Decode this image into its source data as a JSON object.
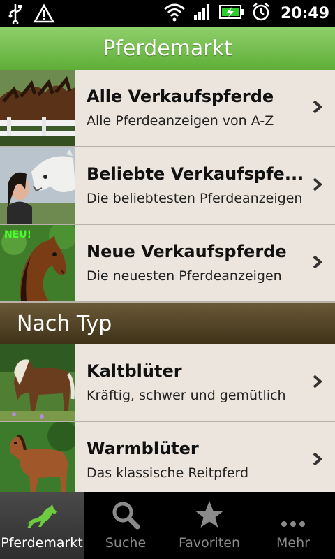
{
  "status_bar": {
    "time": "20:49",
    "icons": [
      "usb-icon",
      "warning-icon",
      "wifi-icon",
      "signal-icon",
      "battery-charging-icon",
      "alarm-icon"
    ]
  },
  "header": {
    "title": "Pferdemarkt"
  },
  "list": {
    "items": [
      {
        "title": "Alle Verkaufspferde",
        "subtitle": "Alle Pferdeanzeigen von A-Z"
      },
      {
        "title": "Beliebte Verkaufspfe...",
        "subtitle": "Die beliebtesten Pferdeanzeigen"
      },
      {
        "title": "Neue Verkaufspferde",
        "subtitle": "Die neuesten Pferdeanzeigen",
        "badge": "NEU!"
      }
    ],
    "section": "Nach Typ",
    "type_items": [
      {
        "title": "Kaltblüter",
        "subtitle": "Kräftig, schwer und gemütlich"
      },
      {
        "title": "Warmblüter",
        "subtitle": "Das klassische Reitpferd"
      }
    ]
  },
  "tabs": [
    {
      "label": "Pferdemarkt",
      "icon": "horse-icon",
      "active": true
    },
    {
      "label": "Suche",
      "icon": "search-icon",
      "active": false
    },
    {
      "label": "Favoriten",
      "icon": "star-icon",
      "active": false
    },
    {
      "label": "Mehr",
      "icon": "more-icon",
      "active": false
    }
  ],
  "colors": {
    "header_green": "#6fbf46",
    "section_brown": "#4f4224",
    "row_bg": "#ebe5dd"
  }
}
